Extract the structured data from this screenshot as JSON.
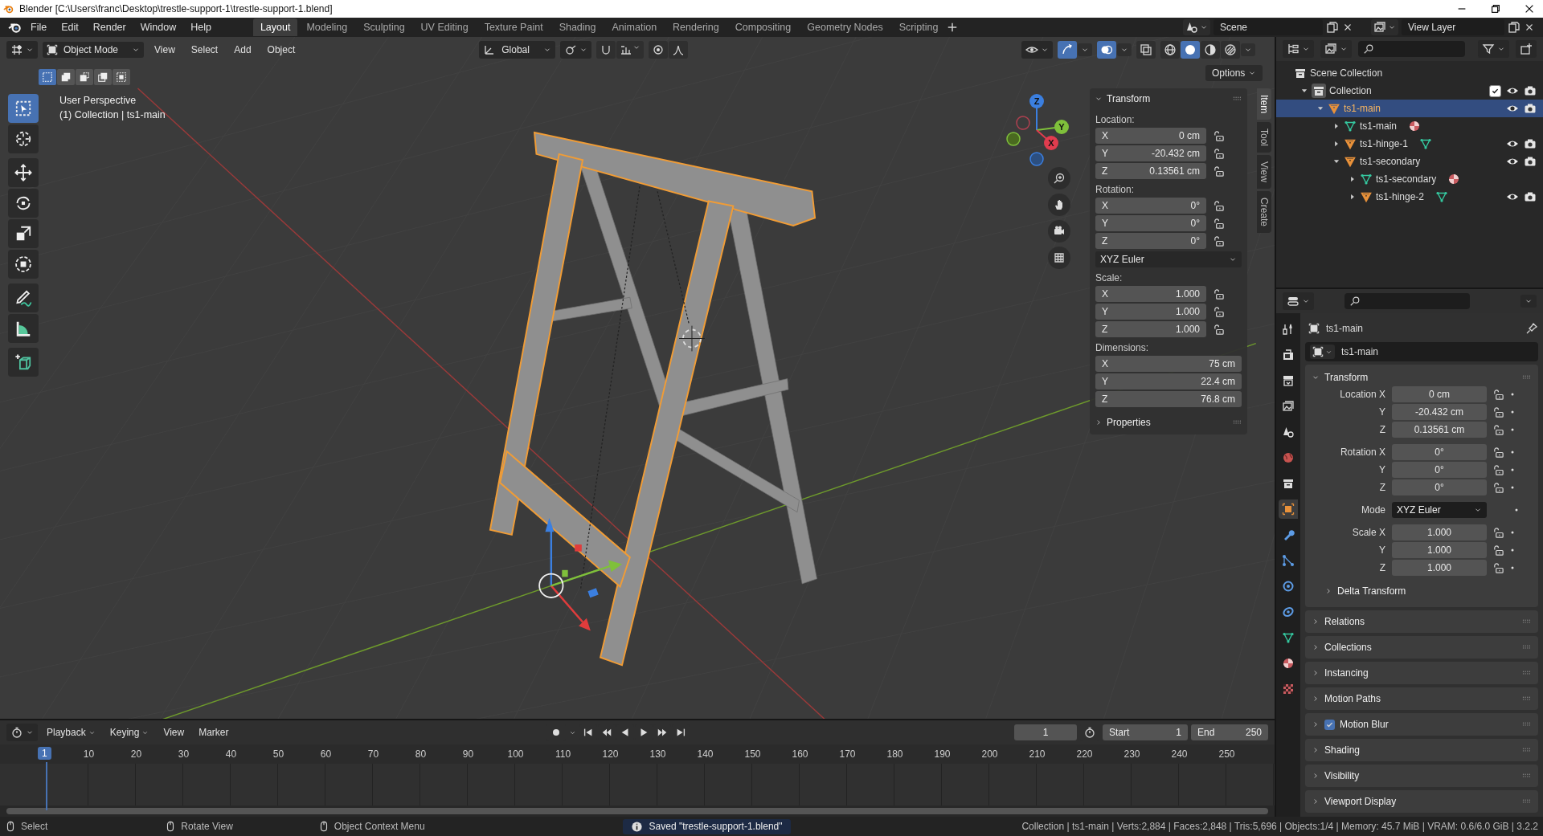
{
  "window": {
    "title": "Blender [C:\\Users\\franc\\Desktop\\trestle-support-1\\trestle-support-1.blend]"
  },
  "menu": [
    "File",
    "Edit",
    "Render",
    "Window",
    "Help"
  ],
  "workspaces": [
    {
      "label": "Layout",
      "selected": true
    },
    {
      "label": "Modeling",
      "selected": false
    },
    {
      "label": "Sculpting",
      "selected": false
    },
    {
      "label": "UV Editing",
      "selected": false
    },
    {
      "label": "Texture Paint",
      "selected": false
    },
    {
      "label": "Shading",
      "selected": false
    },
    {
      "label": "Animation",
      "selected": false
    },
    {
      "label": "Rendering",
      "selected": false
    },
    {
      "label": "Compositing",
      "selected": false
    },
    {
      "label": "Geometry Nodes",
      "selected": false
    },
    {
      "label": "Scripting",
      "selected": false
    }
  ],
  "scene": "Scene",
  "view_layer": "View Layer",
  "viewport": {
    "mode": "Object Mode",
    "menus": [
      "View",
      "Select",
      "Add",
      "Object"
    ],
    "orientation": "Global",
    "options": "Options",
    "overlay": [
      "User Perspective",
      "(1) Collection | ts1-main"
    ],
    "select_modes": [
      {
        "kind": "set",
        "selected": true
      },
      {
        "kind": "extend",
        "selected": false
      },
      {
        "kind": "subtract",
        "selected": false
      },
      {
        "kind": "invert",
        "selected": false
      },
      {
        "kind": "intersect",
        "selected": false
      }
    ],
    "tools": [
      {
        "kind": "select",
        "selected": true
      },
      {
        "kind": "cursor",
        "selected": false
      },
      {
        "kind": "move",
        "selected": false
      },
      {
        "kind": "rotate",
        "selected": false
      },
      {
        "kind": "scale",
        "selected": false
      },
      {
        "kind": "transform",
        "selected": false
      },
      {
        "kind": "annotate",
        "selected": false
      },
      {
        "kind": "measure",
        "selected": false
      },
      {
        "kind": "add-cube",
        "selected": false
      }
    ],
    "shading": [
      {
        "kind": "wireframe",
        "selected": false
      },
      {
        "kind": "solid",
        "selected": true
      },
      {
        "kind": "material",
        "selected": false
      },
      {
        "kind": "rendered",
        "selected": false
      }
    ],
    "gizmo": {
      "x": "X",
      "y": "Y",
      "z": "Z"
    },
    "sidebar_tabs": [
      {
        "label": "Item",
        "selected": true
      },
      {
        "label": "Tool",
        "selected": false
      },
      {
        "label": "View",
        "selected": false
      },
      {
        "label": "Create",
        "selected": false
      }
    ],
    "sidebar": {
      "title": "Transform",
      "properties": "Properties",
      "groups": [
        {
          "label": "Location:",
          "locks": true,
          "fields": [
            {
              "axis": "X",
              "value": "0 cm"
            },
            {
              "axis": "Y",
              "value": "-20.432 cm"
            },
            {
              "axis": "Z",
              "value": "0.13561 cm"
            }
          ]
        },
        {
          "label": "Rotation:",
          "locks": true,
          "mode": "XYZ Euler",
          "fields": [
            {
              "axis": "X",
              "value": "0°"
            },
            {
              "axis": "Y",
              "value": "0°"
            },
            {
              "axis": "Z",
              "value": "0°"
            }
          ]
        },
        {
          "label": "Scale:",
          "locks": true,
          "fields": [
            {
              "axis": "X",
              "value": "1.000"
            },
            {
              "axis": "Y",
              "value": "1.000"
            },
            {
              "axis": "Z",
              "value": "1.000"
            }
          ]
        },
        {
          "label": "Dimensions:",
          "locks": false,
          "fields": [
            {
              "axis": "X",
              "value": "75 cm"
            },
            {
              "axis": "Y",
              "value": "22.4 cm"
            },
            {
              "axis": "Z",
              "value": "76.8 cm"
            }
          ]
        }
      ]
    }
  },
  "outliner": {
    "root": "Scene Collection",
    "items": [
      {
        "label": "Collection",
        "kind": "collection",
        "expanded": true,
        "selected": false,
        "checked": true,
        "restrict": true,
        "children": [
          {
            "label": "ts1-main",
            "kind": "object",
            "expanded": true,
            "selected": true,
            "restrict": true,
            "children": [
              {
                "label": "ts1-main",
                "kind": "mesh",
                "expanded": false,
                "selected": false,
                "restrict": false,
                "badge": {
                  "kind": "material"
                }
              },
              {
                "label": "ts1-hinge-1",
                "kind": "object",
                "expanded": false,
                "selected": false,
                "restrict": true,
                "badge": {
                  "kind": "mesh"
                }
              },
              {
                "label": "ts1-secondary",
                "kind": "object",
                "expanded": true,
                "selected": false,
                "restrict": true,
                "children": [
                  {
                    "label": "ts1-secondary",
                    "kind": "mesh",
                    "expanded": false,
                    "selected": false,
                    "restrict": false,
                    "badge": {
                      "kind": "material"
                    }
                  },
                  {
                    "label": "ts1-hinge-2",
                    "kind": "object",
                    "expanded": false,
                    "selected": false,
                    "restrict": true,
                    "badge": {
                      "kind": "mesh"
                    }
                  }
                ]
              }
            ]
          }
        ]
      }
    ]
  },
  "properties": {
    "tabs": [
      {
        "kind": "tool",
        "selected": false
      },
      {
        "kind": "render",
        "selected": false
      },
      {
        "kind": "output",
        "selected": false
      },
      {
        "kind": "view-layer",
        "selected": false
      },
      {
        "kind": "scene",
        "selected": false
      },
      {
        "kind": "world",
        "selected": false
      },
      {
        "kind": "collection",
        "selected": false
      },
      {
        "kind": "object",
        "selected": true
      },
      {
        "kind": "modifiers",
        "selected": false
      },
      {
        "kind": "particles",
        "selected": false
      },
      {
        "kind": "physics",
        "selected": false
      },
      {
        "kind": "constraints",
        "selected": false
      },
      {
        "kind": "data",
        "selected": false
      },
      {
        "kind": "material",
        "selected": false
      },
      {
        "kind": "texture",
        "selected": false
      }
    ],
    "object": "ts1-main",
    "name": "ts1-main",
    "transform_title": "Transform",
    "delta": "Delta Transform",
    "rows": [
      {
        "kind": "number",
        "label": "Location X",
        "value": "0 cm"
      },
      {
        "kind": "number",
        "label": "Y",
        "value": "-20.432 cm"
      },
      {
        "kind": "number",
        "label": "Z",
        "value": "0.13561 cm"
      },
      {
        "kind": "number",
        "label": "Rotation X",
        "value": "0°"
      },
      {
        "kind": "number",
        "label": "Y",
        "value": "0°"
      },
      {
        "kind": "number",
        "label": "Z",
        "value": "0°"
      },
      {
        "kind": "dropdown",
        "label": "Mode",
        "value": "XYZ Euler"
      },
      {
        "kind": "number",
        "label": "Scale X",
        "value": "1.000"
      },
      {
        "kind": "number",
        "label": "Y",
        "value": "1.000"
      },
      {
        "kind": "number",
        "label": "Z",
        "value": "1.000"
      }
    ],
    "panels": [
      {
        "kind": "plain",
        "label": "Relations"
      },
      {
        "kind": "plain",
        "label": "Collections"
      },
      {
        "kind": "plain",
        "label": "Instancing"
      },
      {
        "kind": "plain",
        "label": "Motion Paths"
      },
      {
        "kind": "checkbox",
        "label": "Motion Blur",
        "checked": true
      },
      {
        "kind": "plain",
        "label": "Shading"
      },
      {
        "kind": "plain",
        "label": "Visibility"
      },
      {
        "kind": "plain",
        "label": "Viewport Display"
      }
    ]
  },
  "timeline": {
    "menus": [
      "Playback",
      "Keying",
      "View",
      "Marker"
    ],
    "frame": "1",
    "start_label": "Start",
    "start": "1",
    "end_label": "End",
    "end": "250",
    "playhead": "1",
    "ticks": [
      "10",
      "20",
      "30",
      "40",
      "50",
      "60",
      "70",
      "80",
      "90",
      "100",
      "110",
      "120",
      "130",
      "140",
      "150",
      "160",
      "170",
      "180",
      "190",
      "200",
      "210",
      "220",
      "230",
      "240",
      "250"
    ]
  },
  "status": {
    "hints": [
      "Select",
      "Rotate View",
      "Object Context Menu"
    ],
    "message": "Saved \"trestle-support-1.blend\"",
    "stats": "Collection | ts1-main | Verts:2,884 | Faces:2,848 | Tris:5,696 | Objects:1/4 | Memory: 45.7 MiB | VRAM: 0.6/6.0 GiB | 3.2.2"
  }
}
